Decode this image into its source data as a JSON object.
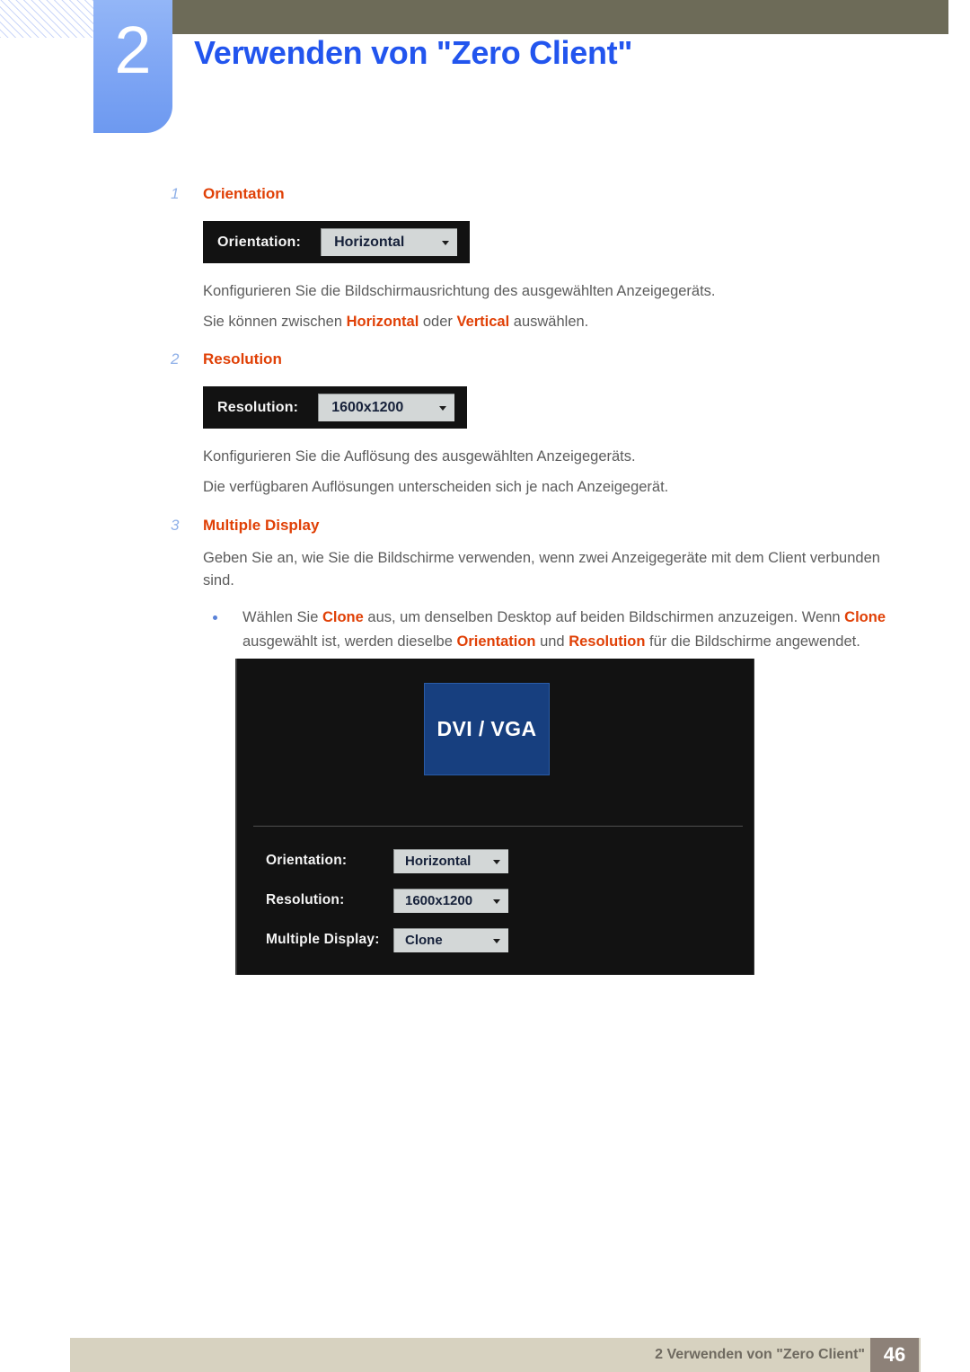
{
  "header": {
    "chapter_number": "2",
    "title": "Verwenden von \"Zero Client\"",
    "accent_blue": "#2255ee",
    "bar_color": "#6d6b58"
  },
  "steps": [
    {
      "number": "1",
      "title": "Orientation",
      "widget": {
        "label": "Orientation:",
        "value": "Horizontal"
      },
      "paragraphs": [
        "Konfigurieren Sie die Bildschirmausrichtung des ausgewählten Anzeigegeräts."
      ],
      "highlight_sentence": {
        "before": "Sie können zwischen ",
        "term1": "Horizontal",
        "middle": " oder ",
        "term2": "Vertical",
        "after": " auswählen."
      }
    },
    {
      "number": "2",
      "title": "Resolution",
      "widget": {
        "label": "Resolution:",
        "value": "1600x1200"
      },
      "paragraphs": [
        "Konfigurieren Sie die Auflösung des ausgewählten Anzeigegeräts.",
        "Die verfügbaren Auflösungen unterscheiden sich je nach Anzeigegerät."
      ]
    },
    {
      "number": "3",
      "title": "Multiple Display",
      "paragraphs": [
        "Geben Sie an, wie Sie die Bildschirme verwenden, wenn zwei Anzeigegeräte mit dem Client verbunden sind."
      ],
      "bullet": {
        "seg1": "Wählen Sie ",
        "term1": "Clone",
        "seg2": " aus, um denselben Desktop auf beiden Bildschirmen anzuzeigen. Wenn ",
        "term2": "Clone",
        "seg3": " ausgewählt ist, werden dieselbe ",
        "term3": "Orientation",
        "seg4": " und ",
        "term4": "Resolution",
        "seg5": " für die Bildschirme angewendet."
      }
    }
  ],
  "panel": {
    "source_label": "DVI / VGA",
    "source_color": "#173f7f",
    "rows": [
      {
        "label": "Orientation:",
        "value": "Horizontal"
      },
      {
        "label": "Resolution:",
        "value": "1600x1200"
      },
      {
        "label": "Multiple Display:",
        "value": "Clone"
      }
    ]
  },
  "footer": {
    "text": "2 Verwenden von \"Zero Client\"",
    "page_number": "46",
    "bar_color": "#d7d2c0",
    "page_box_color": "#8d8178"
  }
}
